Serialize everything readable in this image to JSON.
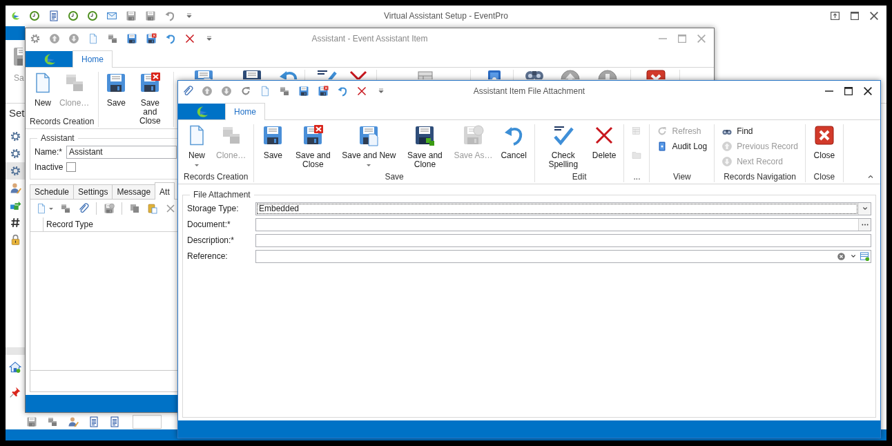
{
  "main_window": {
    "title": "Virtual Assistant Setup - EventPro",
    "ribbon_items": [
      {
        "label": "Sa"
      }
    ],
    "section_title": "Set",
    "sidebar_items": [
      {
        "selected": false
      },
      {
        "selected": false
      },
      {
        "selected": true
      },
      {
        "selected": false
      },
      {
        "selected": false
      },
      {
        "selected": false
      },
      {
        "selected": false
      }
    ]
  },
  "event_window": {
    "title": "Assistant - Event Assistant Item",
    "ribbon_tabs": [
      {
        "label": "Home",
        "selected": true
      }
    ],
    "ribbon_groups": [
      {
        "label": "Records Creation",
        "items": [
          {
            "kind": "large",
            "label": "New",
            "disabled": false
          },
          {
            "kind": "large",
            "label": "Clone…",
            "disabled": true
          }
        ]
      },
      {
        "items": [
          {
            "kind": "large",
            "label": "Save",
            "disabled": false
          },
          {
            "kind": "large",
            "label": "Save and Close",
            "disabled": false
          }
        ]
      }
    ],
    "assistant": {
      "legend": "Assistant",
      "name_label": "Name:*",
      "name_value": "Assistant",
      "inactive_label": "Inactive",
      "inactive_checked": false
    },
    "tabs": [
      {
        "label": "Schedule",
        "selected": false
      },
      {
        "label": "Settings",
        "selected": false
      },
      {
        "label": "Message",
        "selected": false
      },
      {
        "label": "Att",
        "selected": true
      }
    ],
    "grid_columns": [
      "Record Type"
    ]
  },
  "attachment_window": {
    "title": "Assistant Item File Attachment",
    "ribbon_tabs": [
      {
        "label": "Home",
        "selected": true
      }
    ],
    "ribbon_groups": [
      {
        "label": "Records Creation",
        "items": [
          {
            "kind": "large",
            "label": "New",
            "disabled": false,
            "dropdown": true
          },
          {
            "kind": "large",
            "label": "Clone…",
            "disabled": true
          }
        ]
      },
      {
        "label": "Save",
        "items": [
          {
            "kind": "large",
            "label": "Save",
            "disabled": false
          },
          {
            "kind": "large",
            "label": "Save and Close",
            "disabled": false
          },
          {
            "kind": "large",
            "label": "Save and New",
            "disabled": false,
            "dropdown": true
          },
          {
            "kind": "large",
            "label": "Save and Clone",
            "disabled": false
          },
          {
            "kind": "large",
            "label": "Save As…",
            "disabled": true
          },
          {
            "kind": "large",
            "label": "Cancel",
            "disabled": false
          }
        ]
      },
      {
        "label": "Edit",
        "items": [
          {
            "kind": "large",
            "label": "Check Spelling",
            "disabled": false
          },
          {
            "kind": "large",
            "label": "Delete",
            "disabled": false
          }
        ]
      },
      {
        "label": "...",
        "items": [
          {
            "kind": "icon",
            "disabled": true
          },
          {
            "kind": "icon",
            "disabled": true
          }
        ]
      },
      {
        "label": "View",
        "items": [
          {
            "kind": "small",
            "label": "Refresh",
            "disabled": true
          },
          {
            "kind": "small",
            "label": "Audit Log",
            "disabled": false
          }
        ]
      },
      {
        "label": "Records Navigation",
        "items": [
          {
            "kind": "small",
            "label": "Find",
            "disabled": false
          },
          {
            "kind": "small",
            "label": "Previous Record",
            "disabled": true
          },
          {
            "kind": "small",
            "label": "Next Record",
            "disabled": true
          }
        ]
      },
      {
        "label": "Close",
        "items": [
          {
            "kind": "large",
            "label": "Close",
            "disabled": false
          }
        ]
      }
    ],
    "form": {
      "legend": "File Attachment",
      "fields": [
        {
          "kind": "dropdown",
          "label": "Storage Type:",
          "value": "Embedded"
        },
        {
          "kind": "browse",
          "label": "Document:*"
        },
        {
          "kind": "text",
          "label": "Description:*"
        },
        {
          "kind": "lookup",
          "label": "Reference:"
        }
      ]
    }
  }
}
